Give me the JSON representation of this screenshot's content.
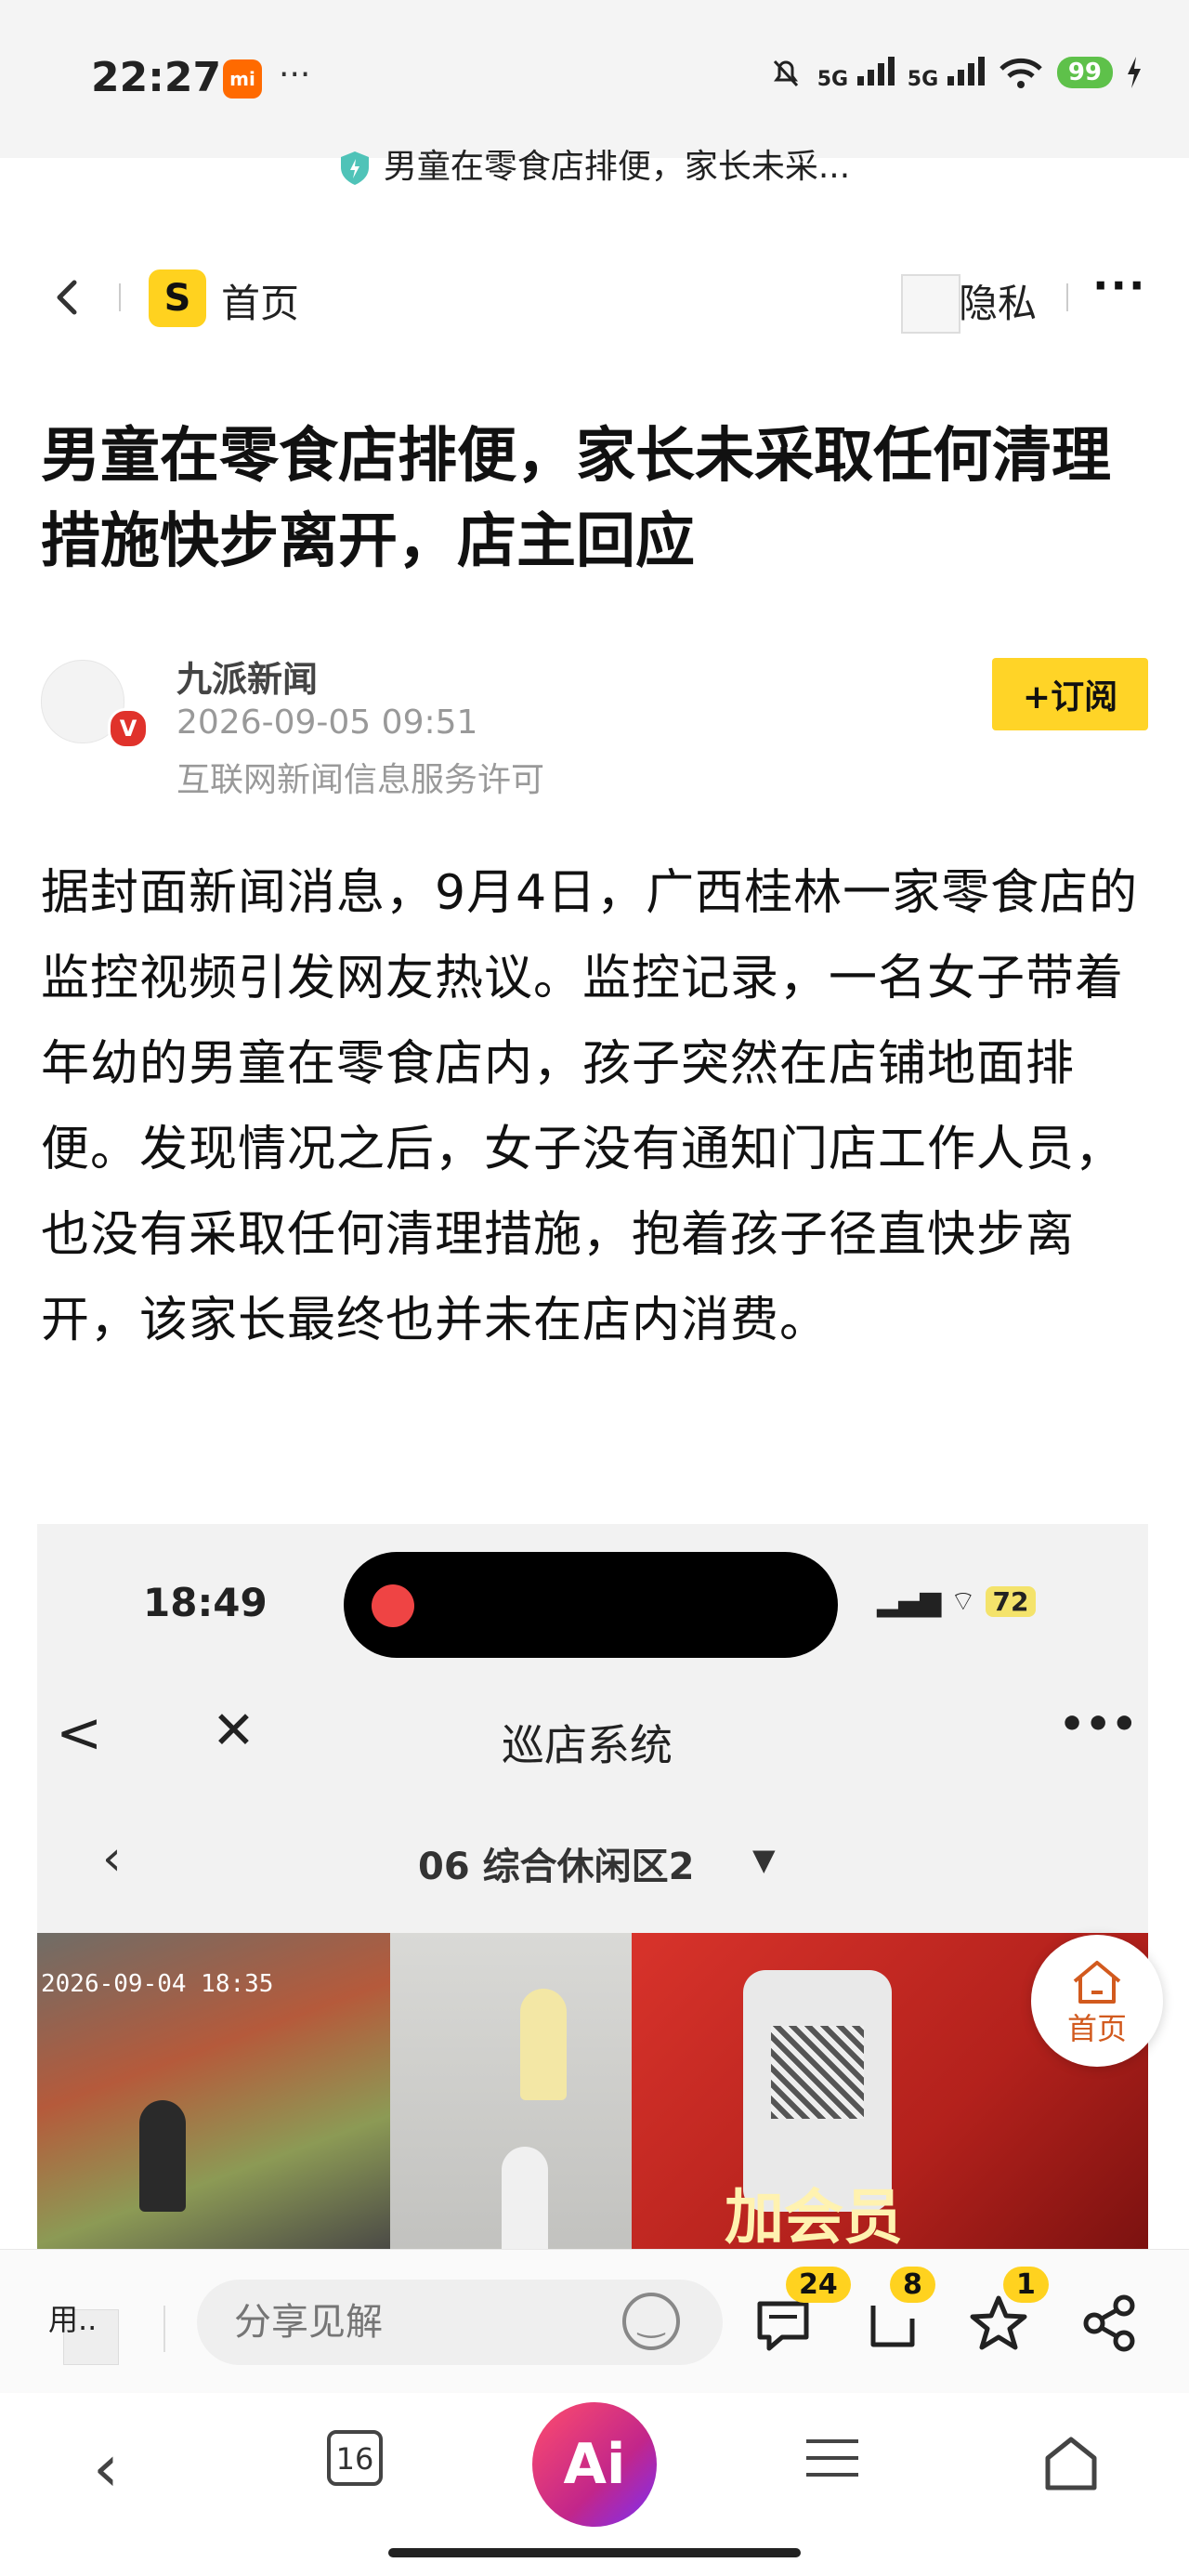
{
  "status_bar": {
    "time": "22:27",
    "mi_badge": "mi",
    "dots": "···",
    "sig1": "5G",
    "sig2": "5G",
    "battery": "99"
  },
  "url_bar": {
    "title": "男童在零食店排便，家长未采..."
  },
  "nav": {
    "home_label": "首页",
    "logo_text": "S",
    "privacy_label": "隐私",
    "more_label": "···"
  },
  "article": {
    "title": "男童在零食店排便，家长未采取任何清理措施快步离开，店主回应",
    "author": "九派新闻",
    "author_badge": "V",
    "date": "2026-09-05 09:51",
    "license": "互联网新闻信息服务许可",
    "subscribe_label": "+订阅",
    "body": "据封面新闻消息，9月4日，广西桂林一家零食店的监控视频引发网友热议。监控记录，一名女子带着年幼的男童在零食店内，孩子突然在店铺地面排便。发现情况之后，女子没有通知门店工作人员，也没有采取任何清理措施，抱着孩子径直快步离开，该家长最终也并未在店内消费。"
  },
  "embedded": {
    "time": "18:49",
    "battery": "72",
    "back": "<",
    "close": "✕",
    "title": "巡店系统",
    "more": "•••",
    "sub_title": "06 综合休闲区2",
    "timestamp": "2026-09-04 18:35",
    "poster_text": "加会员"
  },
  "floating": {
    "home_label": "首页"
  },
  "comment_bar": {
    "user_label": "用..",
    "placeholder": "分享见解",
    "comments_count": "24",
    "tabs_count": "8",
    "fav_count": "1"
  },
  "bottom_nav": {
    "tabs_count": "16",
    "ai_label": "Ai"
  },
  "colors": {
    "accent": "#ffd21f",
    "badge_red": "#e0322b",
    "float_home": "#d25a1e"
  }
}
